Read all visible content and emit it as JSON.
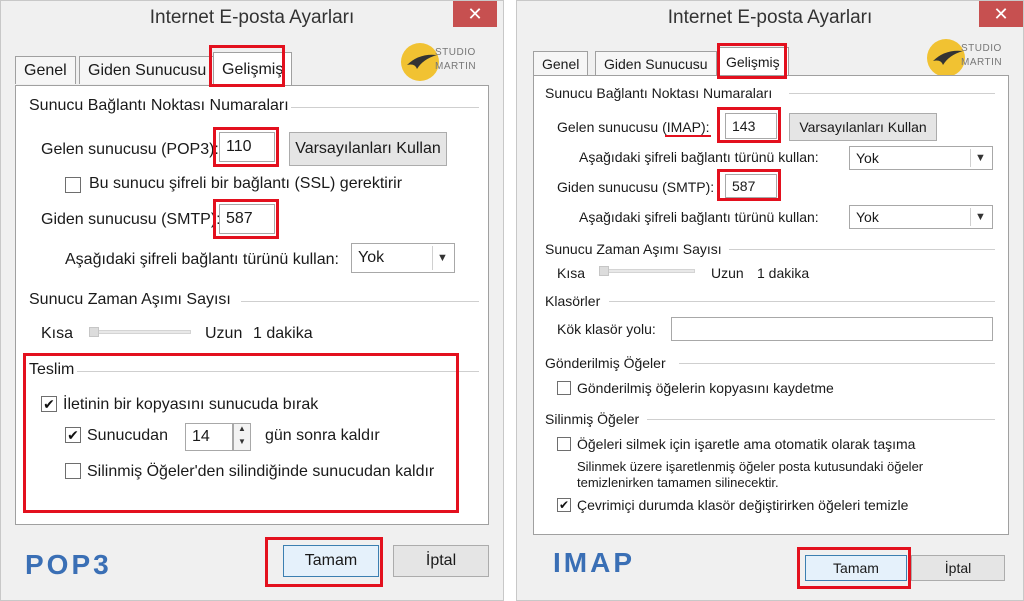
{
  "left": {
    "title": "Internet E-posta Ayarları",
    "close": "✕",
    "logo": {
      "line1": "STUDIO",
      "line2": "MARTIN"
    },
    "tabs": [
      "Genel",
      "Giden Sunucusu",
      "Gelişmiş"
    ],
    "server_ports": {
      "heading": "Sunucu Bağlantı Noktası Numaraları",
      "incoming_label": "Gelen sunucusu (POP3):",
      "incoming_value": "110",
      "defaults_button": "Varsayılanları Kullan",
      "ssl_checkbox": "Bu sunucu şifreli bir bağlantı (SSL) gerektirir",
      "ssl_checked": false,
      "outgoing_label": "Giden sunucusu (SMTP):",
      "outgoing_value": "587",
      "encryption_label": "Aşağıdaki şifreli bağlantı türünü kullan:",
      "encryption_value": "Yok"
    },
    "timeout": {
      "heading": "Sunucu Zaman Aşımı Sayısı",
      "short": "Kısa",
      "long": "Uzun",
      "value": "1 dakika",
      "level": 0.0
    },
    "delivery": {
      "heading": "Teslim",
      "leave_copy": "İletinin bir kopyasını sunucuda bırak",
      "leave_copy_checked": true,
      "remove_after": "Sunucudan",
      "remove_after_checked": true,
      "days_value": "14",
      "days_suffix": "gün sonra kaldır",
      "remove_when_deleted": "Silinmiş Öğeler'den silindiğinde sunucudan kaldır",
      "remove_when_deleted_checked": false
    },
    "ok": "Tamam",
    "cancel": "İptal",
    "protocol": "POP3"
  },
  "right": {
    "title": "Internet E-posta Ayarları",
    "close": "✕",
    "logo": {
      "line1": "STUDIO",
      "line2": "MARTIN"
    },
    "tabs": [
      "Genel",
      "Giden Sunucusu",
      "Gelişmiş"
    ],
    "server_ports": {
      "heading": "Sunucu Bağlantı Noktası Numaraları",
      "incoming_label_prefix": "Gelen sunucusu ",
      "incoming_label_proto": "(IMAP)",
      "incoming_label_suffix": ":",
      "incoming_value": "143",
      "defaults_button": "Varsayılanları Kullan",
      "incoming_encryption_label": "Aşağıdaki şifreli bağlantı türünü kullan:",
      "incoming_encryption_value": "Yok",
      "outgoing_label": "Giden sunucusu (SMTP):",
      "outgoing_value": "587",
      "outgoing_encryption_label": "Aşağıdaki şifreli bağlantı türünü kullan:",
      "outgoing_encryption_value": "Yok"
    },
    "timeout": {
      "heading": "Sunucu Zaman Aşımı Sayısı",
      "short": "Kısa",
      "long": "Uzun",
      "value": "1 dakika",
      "level": 0.0
    },
    "folders": {
      "heading": "Klasörler",
      "root_label": "Kök klasör yolu:",
      "root_value": ""
    },
    "sent": {
      "heading": "Gönderilmiş Öğeler",
      "dont_save": "Gönderilmiş öğelerin kopyasını kaydetme",
      "dont_save_checked": false
    },
    "deleted": {
      "heading": "Silinmiş Öğeler",
      "mark_only": "Öğeleri silmek için işaretle ama otomatik olarak taşıma",
      "mark_only_checked": false,
      "note_line1": "Silinmek üzere işaretlenmiş öğeler posta kutusundaki öğeler",
      "note_line2": "temizlenirken tamamen silinecektir.",
      "purge_online": "Çevrimiçi durumda klasör değiştirirken öğeleri temizle",
      "purge_online_checked": true
    },
    "ok": "Tamam",
    "cancel": "İptal",
    "protocol": "IMAP"
  }
}
